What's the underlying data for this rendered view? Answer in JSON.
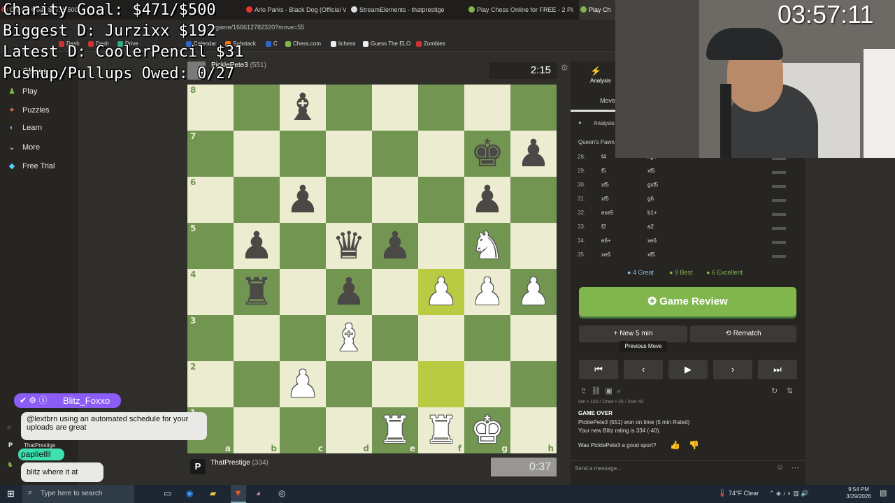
{
  "browser": {
    "tabs": [
      {
        "label": "Charity Goal: $471/$500",
        "active": false
      },
      {
        "label": "Arlo Parks - Black Dog (Official Vi",
        "active": false
      },
      {
        "label": "StreamElements - thatprestige",
        "active": false
      },
      {
        "label": "Play Chess Online for FREE - 2 Player",
        "active": false
      },
      {
        "label": "Play Ch",
        "active": true
      }
    ],
    "url": "game/166612782320?move=55",
    "bookmarks": [
      "Dash",
      "Dash",
      "Drive",
      "Calendar",
      "Substack",
      "C",
      "Chess.com",
      "lichess",
      "Guess The ELO",
      "Zombies"
    ]
  },
  "overlay": {
    "line1": "Charity Goal: $471/$500",
    "line2": "Biggest D: Jurzixx $192",
    "line3": "Latest D: CoolerPencil $31",
    "line4": "Pushup/Pullups Owed: 0/27",
    "timer": "03:57:11"
  },
  "sidebar": {
    "logo": "Chess",
    "items": [
      {
        "label": "Play",
        "icon": "pawn-icon"
      },
      {
        "label": "Puzzles",
        "icon": "puzzle-icon"
      },
      {
        "label": "Learn",
        "icon": "book-icon"
      },
      {
        "label": "More",
        "icon": "chevron-down-icon"
      },
      {
        "label": "Free Trial",
        "icon": "diamond-icon"
      }
    ]
  },
  "top_player": {
    "name": "PicklePete3",
    "rating": "(551)",
    "clock": "2:15"
  },
  "bottom_player": {
    "name": "ThatPrestige",
    "rating": "(334)",
    "clock": "0:37"
  },
  "board": {
    "ranks": [
      "8",
      "7",
      "6",
      "5",
      "4",
      "3",
      "2",
      "1"
    ],
    "files": [
      "a",
      "b",
      "c",
      "d",
      "e",
      "f",
      "g",
      "h"
    ],
    "rows": [
      [
        "",
        "",
        "bB",
        "",
        "",
        "",
        "",
        ""
      ],
      [
        "",
        "",
        "",
        "",
        "",
        "",
        "bK",
        "bP"
      ],
      [
        "",
        "",
        "bP",
        "",
        "",
        "",
        "bP",
        ""
      ],
      [
        "",
        "bP",
        "",
        "bQ",
        "bP",
        "",
        "wN",
        ""
      ],
      [
        "",
        "bR",
        "",
        "bP",
        "",
        "wP",
        "wP",
        "wP"
      ],
      [
        "",
        "",
        "",
        "wB",
        "",
        "",
        "",
        ""
      ],
      [
        "",
        "",
        "wP",
        "",
        "",
        "",
        "",
        ""
      ],
      [
        "",
        "",
        "",
        "",
        "wR",
        "wR",
        "wK",
        ""
      ]
    ],
    "highlight": [
      "f4",
      "f2"
    ]
  },
  "panel": {
    "tab_analysis": "Analysis",
    "tab_moves": "Move",
    "sub_analysis": "Analysis",
    "opening": "Queen's Pawn",
    "moves": [
      {
        "n": "28.",
        "w": "f4",
        "b": "xg4"
      },
      {
        "n": "29.",
        "w": "f5",
        "b": "xf5"
      },
      {
        "n": "30.",
        "w": "xf5",
        "b": "gxf5"
      },
      {
        "n": "31.",
        "w": "xf5",
        "b": "g6"
      },
      {
        "n": "32.",
        "w": "exe5",
        "b": "b1+"
      },
      {
        "n": "33.",
        "w": "f2",
        "b": "a2"
      },
      {
        "n": "34.",
        "w": "e6+",
        "b": "xe6"
      },
      {
        "n": "35.",
        "w": "xe6",
        "b": "xf5"
      }
    ],
    "stats": [
      {
        "label": "4 Great",
        "color": "#749bbf"
      },
      {
        "label": "9 Best",
        "color": "#81b64c"
      },
      {
        "label": "6 Excellent",
        "color": "#81b64c"
      }
    ],
    "game_review": "Game Review",
    "new_game": "New 5 min",
    "rematch": "Rematch",
    "tooltip": "Previous Move",
    "result_partial": "win • 100 / Draw • 35 / lose 40",
    "game_over": "GAME OVER",
    "result": "PicklePete3 (551) won on time (5 min Rated)",
    "new_rating": "Your new Blitz rating is 334 (-40).",
    "sport_q": "Was PicklePete3 a good sport?",
    "message_placeholder": "Send a message..."
  },
  "chat": {
    "user1": "Blitz_Foxxo",
    "msg1": "@lextbrn using an automated schedule for your uploads are great",
    "user2": "ThatPrestige",
    "user3": "papliellll",
    "msg2": "blitz where it at"
  },
  "taskbar": {
    "search": "Type here to search",
    "weather": "74°F  Clear",
    "time": "9:54 PM",
    "date": "3/29/2026"
  },
  "colors": {
    "board_light": "#ebecd0",
    "board_dark": "#739552",
    "highlight": "#b9ca43",
    "review_green": "#81b64c"
  }
}
